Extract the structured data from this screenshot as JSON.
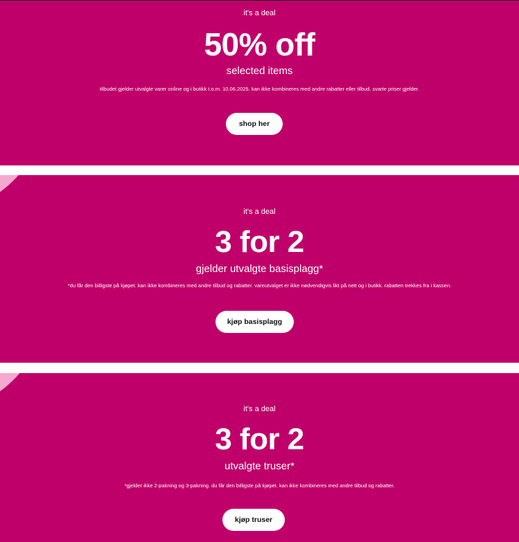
{
  "colors": {
    "banner_background": "#c0006a",
    "accent_blob": "#f7a8d0",
    "button_background": "#ffffff",
    "button_text": "#111111"
  },
  "banners": [
    {
      "eyebrow": "it's a deal",
      "headline": "50% off",
      "subline": "selected items",
      "fine_print": "tilbudet gjelder utvalgte varer online og i butikk t.o.m. 10.06.2025. kan ikke kombineres med andre rabatter eller tilbud. svarte priser gjelder.",
      "button_label": "shop her"
    },
    {
      "eyebrow": "it's a deal",
      "headline": "3 for 2",
      "subline": "gjelder utvalgte basisplagg*",
      "fine_print": "*du får den billigste på kjøpet. kan ikke kombineres med andre tilbud og rabatter. vareutvalget er ikke nødvendigvis likt på nett og i butikk. rabatten trekkes fra i kassen.",
      "button_label": "kjøp basisplagg"
    },
    {
      "eyebrow": "it's a deal",
      "headline": "3 for 2",
      "subline": "utvalgte truser*",
      "fine_print": "*gjelder ikke 2-pakning og 3-pakning. du får den billigste på kjøpet. kan ikke kombineres med andre tilbud og rabatter.",
      "button_label": "kjøp truser"
    }
  ]
}
